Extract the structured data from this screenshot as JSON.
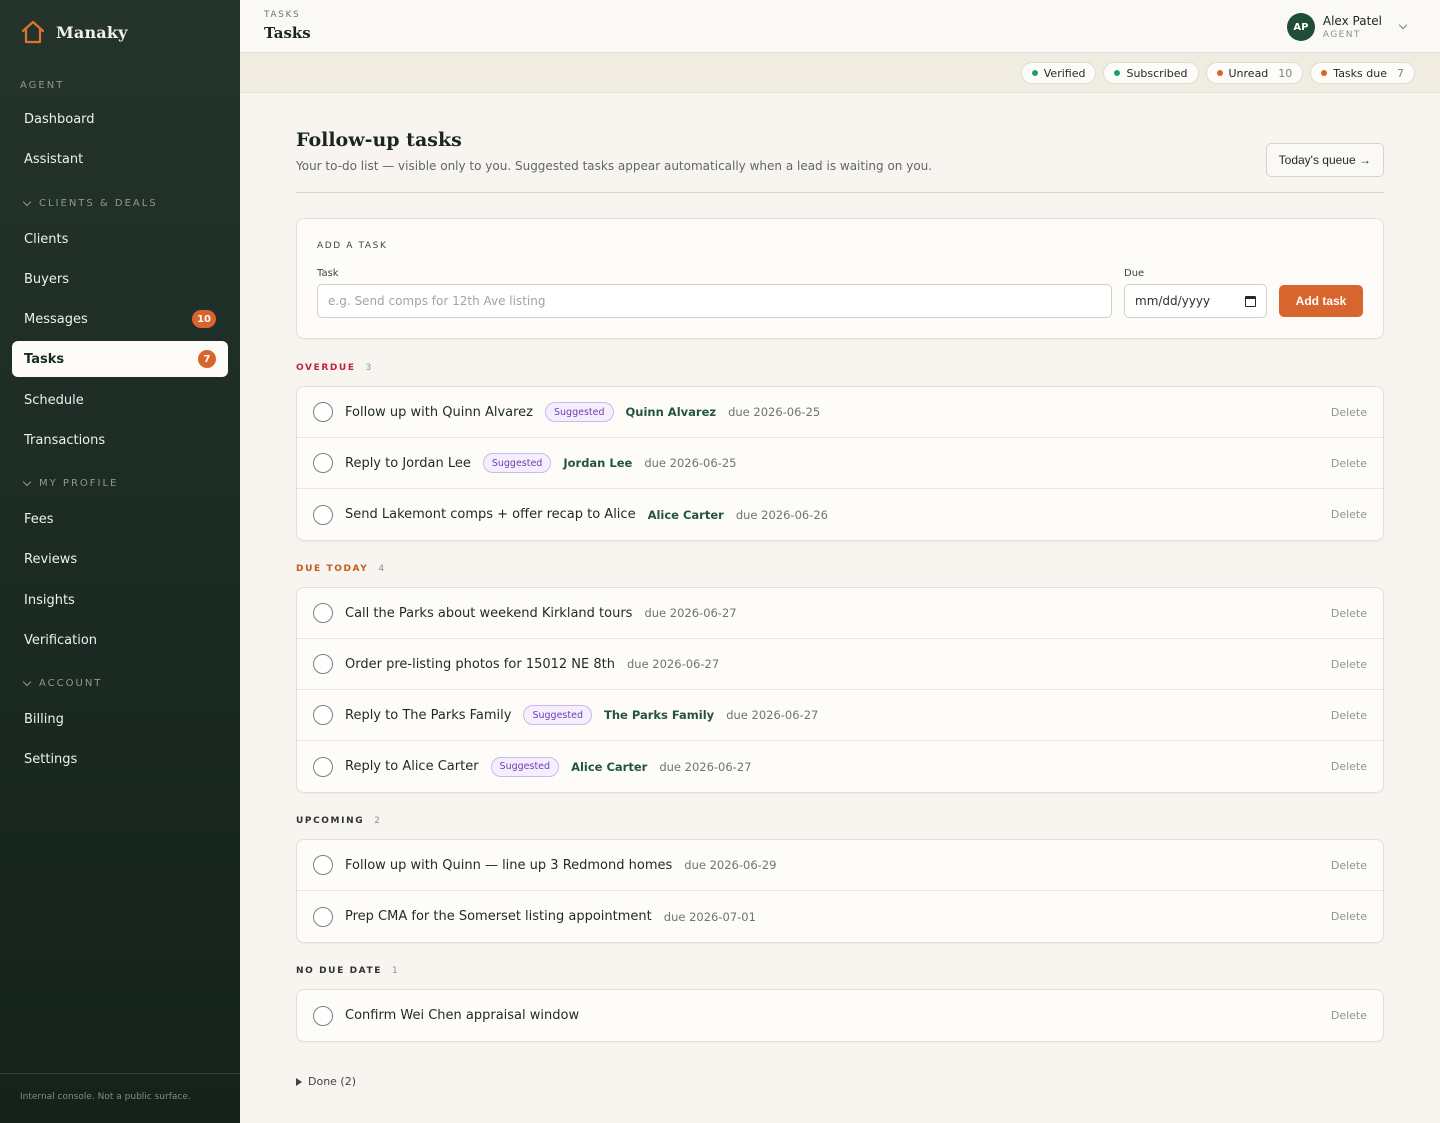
{
  "brand": {
    "name": "Manaky",
    "icon": "house-icon",
    "accent": "#d8652e"
  },
  "sidebar": {
    "sections": [
      {
        "label": "Agent",
        "collapsible": false
      },
      {
        "label": "Clients & Deals",
        "collapsible": true
      },
      {
        "label": "My Profile",
        "collapsible": true
      },
      {
        "label": "Account",
        "collapsible": true
      }
    ],
    "items": [
      {
        "label": "Dashboard"
      },
      {
        "label": "Assistant"
      },
      {
        "label": "Clients"
      },
      {
        "label": "Buyers"
      },
      {
        "label": "Messages",
        "badge": "10"
      },
      {
        "label": "Tasks",
        "badge": "7",
        "active": true
      },
      {
        "label": "Schedule"
      },
      {
        "label": "Transactions"
      },
      {
        "label": "Fees"
      },
      {
        "label": "Reviews"
      },
      {
        "label": "Insights"
      },
      {
        "label": "Verification"
      },
      {
        "label": "Billing"
      },
      {
        "label": "Settings"
      }
    ],
    "footer": "Internal console. Not a public surface."
  },
  "header": {
    "breadcrumb": "TASKS",
    "title": "Tasks",
    "user": {
      "initials": "AP",
      "name": "Alex Patel",
      "role": "AGENT"
    }
  },
  "status": [
    {
      "label": "Verified",
      "color": "#1f9d6b"
    },
    {
      "label": "Subscribed",
      "color": "#1f9d6b"
    },
    {
      "label": "Unread",
      "count": "10",
      "color": "#d8652e"
    },
    {
      "label": "Tasks due",
      "count": "7",
      "color": "#d8652e"
    }
  ],
  "page": {
    "title": "Follow-up tasks",
    "subtitle": "Your to-do list — visible only to you. Suggested tasks appear automatically when a lead is waiting on you.",
    "queue_button": "Today's queue →"
  },
  "add_task": {
    "title": "ADD A TASK",
    "task_label": "Task",
    "task_placeholder": "e.g. Send comps for 12th Ave listing",
    "due_label": "Due",
    "due_placeholder": "mm/dd/yyyy",
    "button": "Add task"
  },
  "groups": [
    {
      "label": "OVERDUE",
      "count": "3",
      "color": "#c0233c",
      "tasks": [
        {
          "text": "Follow up with Quinn Alvarez",
          "tag": "Suggested",
          "contact": "Quinn Alvarez",
          "due": "due 2026-06-25"
        },
        {
          "text": "Reply to Jordan Lee",
          "tag": "Suggested",
          "contact": "Jordan Lee",
          "due": "due 2026-06-25"
        },
        {
          "text": "Send Lakemont comps + offer recap to Alice",
          "tag": "",
          "contact": "Alice Carter",
          "due": "due 2026-06-26"
        }
      ]
    },
    {
      "label": "DUE TODAY",
      "count": "4",
      "color": "#c65a1e",
      "tasks": [
        {
          "text": "Call the Parks about weekend Kirkland tours",
          "tag": "",
          "contact": "",
          "due": "due 2026-06-27"
        },
        {
          "text": "Order pre-listing photos for 15012 NE 8th",
          "tag": "",
          "contact": "",
          "due": "due 2026-06-27"
        },
        {
          "text": "Reply to The Parks Family",
          "tag": "Suggested",
          "contact": "The Parks Family",
          "due": "due 2026-06-27"
        },
        {
          "text": "Reply to Alice Carter",
          "tag": "Suggested",
          "contact": "Alice Carter",
          "due": "due 2026-06-27"
        }
      ]
    },
    {
      "label": "UPCOMING",
      "count": "2",
      "color": "#2b332e",
      "tasks": [
        {
          "text": "Follow up with Quinn — line up 3 Redmond homes",
          "tag": "",
          "contact": "",
          "due": "due 2026-06-29"
        },
        {
          "text": "Prep CMA for the Somerset listing appointment",
          "tag": "",
          "contact": "",
          "due": "due 2026-07-01"
        }
      ]
    },
    {
      "label": "NO DUE DATE",
      "count": "1",
      "color": "#2b332e",
      "tasks": [
        {
          "text": "Confirm Wei Chen appraisal window",
          "tag": "",
          "contact": "",
          "due": ""
        }
      ]
    }
  ],
  "delete_label": "Delete",
  "done_toggle": "Done (2)"
}
